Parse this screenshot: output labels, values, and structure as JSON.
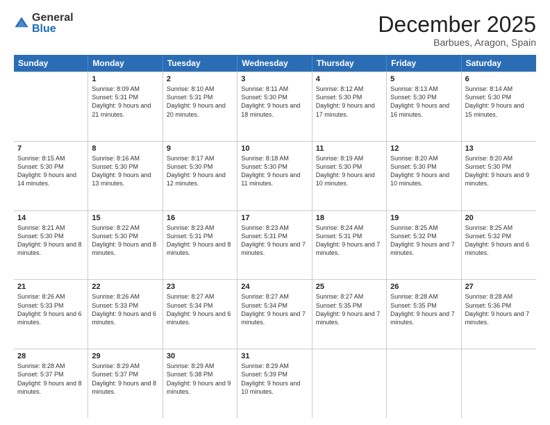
{
  "logo": {
    "general": "General",
    "blue": "Blue"
  },
  "header": {
    "month": "December 2025",
    "location": "Barbues, Aragon, Spain"
  },
  "weekdays": [
    "Sunday",
    "Monday",
    "Tuesday",
    "Wednesday",
    "Thursday",
    "Friday",
    "Saturday"
  ],
  "rows": [
    [
      {
        "day": "",
        "sunrise": "",
        "sunset": "",
        "daylight": ""
      },
      {
        "day": "1",
        "sunrise": "Sunrise: 8:09 AM",
        "sunset": "Sunset: 5:31 PM",
        "daylight": "Daylight: 9 hours and 21 minutes."
      },
      {
        "day": "2",
        "sunrise": "Sunrise: 8:10 AM",
        "sunset": "Sunset: 5:31 PM",
        "daylight": "Daylight: 9 hours and 20 minutes."
      },
      {
        "day": "3",
        "sunrise": "Sunrise: 8:11 AM",
        "sunset": "Sunset: 5:30 PM",
        "daylight": "Daylight: 9 hours and 18 minutes."
      },
      {
        "day": "4",
        "sunrise": "Sunrise: 8:12 AM",
        "sunset": "Sunset: 5:30 PM",
        "daylight": "Daylight: 9 hours and 17 minutes."
      },
      {
        "day": "5",
        "sunrise": "Sunrise: 8:13 AM",
        "sunset": "Sunset: 5:30 PM",
        "daylight": "Daylight: 9 hours and 16 minutes."
      },
      {
        "day": "6",
        "sunrise": "Sunrise: 8:14 AM",
        "sunset": "Sunset: 5:30 PM",
        "daylight": "Daylight: 9 hours and 15 minutes."
      }
    ],
    [
      {
        "day": "7",
        "sunrise": "Sunrise: 8:15 AM",
        "sunset": "Sunset: 5:30 PM",
        "daylight": "Daylight: 9 hours and 14 minutes."
      },
      {
        "day": "8",
        "sunrise": "Sunrise: 8:16 AM",
        "sunset": "Sunset: 5:30 PM",
        "daylight": "Daylight: 9 hours and 13 minutes."
      },
      {
        "day": "9",
        "sunrise": "Sunrise: 8:17 AM",
        "sunset": "Sunset: 5:30 PM",
        "daylight": "Daylight: 9 hours and 12 minutes."
      },
      {
        "day": "10",
        "sunrise": "Sunrise: 8:18 AM",
        "sunset": "Sunset: 5:30 PM",
        "daylight": "Daylight: 9 hours and 11 minutes."
      },
      {
        "day": "11",
        "sunrise": "Sunrise: 8:19 AM",
        "sunset": "Sunset: 5:30 PM",
        "daylight": "Daylight: 9 hours and 10 minutes."
      },
      {
        "day": "12",
        "sunrise": "Sunrise: 8:20 AM",
        "sunset": "Sunset: 5:30 PM",
        "daylight": "Daylight: 9 hours and 10 minutes."
      },
      {
        "day": "13",
        "sunrise": "Sunrise: 8:20 AM",
        "sunset": "Sunset: 5:30 PM",
        "daylight": "Daylight: 9 hours and 9 minutes."
      }
    ],
    [
      {
        "day": "14",
        "sunrise": "Sunrise: 8:21 AM",
        "sunset": "Sunset: 5:30 PM",
        "daylight": "Daylight: 9 hours and 8 minutes."
      },
      {
        "day": "15",
        "sunrise": "Sunrise: 8:22 AM",
        "sunset": "Sunset: 5:30 PM",
        "daylight": "Daylight: 9 hours and 8 minutes."
      },
      {
        "day": "16",
        "sunrise": "Sunrise: 8:23 AM",
        "sunset": "Sunset: 5:31 PM",
        "daylight": "Daylight: 9 hours and 8 minutes."
      },
      {
        "day": "17",
        "sunrise": "Sunrise: 8:23 AM",
        "sunset": "Sunset: 5:31 PM",
        "daylight": "Daylight: 9 hours and 7 minutes."
      },
      {
        "day": "18",
        "sunrise": "Sunrise: 8:24 AM",
        "sunset": "Sunset: 5:31 PM",
        "daylight": "Daylight: 9 hours and 7 minutes."
      },
      {
        "day": "19",
        "sunrise": "Sunrise: 8:25 AM",
        "sunset": "Sunset: 5:32 PM",
        "daylight": "Daylight: 9 hours and 7 minutes."
      },
      {
        "day": "20",
        "sunrise": "Sunrise: 8:25 AM",
        "sunset": "Sunset: 5:32 PM",
        "daylight": "Daylight: 9 hours and 6 minutes."
      }
    ],
    [
      {
        "day": "21",
        "sunrise": "Sunrise: 8:26 AM",
        "sunset": "Sunset: 5:33 PM",
        "daylight": "Daylight: 9 hours and 6 minutes."
      },
      {
        "day": "22",
        "sunrise": "Sunrise: 8:26 AM",
        "sunset": "Sunset: 5:33 PM",
        "daylight": "Daylight: 9 hours and 6 minutes."
      },
      {
        "day": "23",
        "sunrise": "Sunrise: 8:27 AM",
        "sunset": "Sunset: 5:34 PM",
        "daylight": "Daylight: 9 hours and 6 minutes."
      },
      {
        "day": "24",
        "sunrise": "Sunrise: 8:27 AM",
        "sunset": "Sunset: 5:34 PM",
        "daylight": "Daylight: 9 hours and 7 minutes."
      },
      {
        "day": "25",
        "sunrise": "Sunrise: 8:27 AM",
        "sunset": "Sunset: 5:35 PM",
        "daylight": "Daylight: 9 hours and 7 minutes."
      },
      {
        "day": "26",
        "sunrise": "Sunrise: 8:28 AM",
        "sunset": "Sunset: 5:35 PM",
        "daylight": "Daylight: 9 hours and 7 minutes."
      },
      {
        "day": "27",
        "sunrise": "Sunrise: 8:28 AM",
        "sunset": "Sunset: 5:36 PM",
        "daylight": "Daylight: 9 hours and 7 minutes."
      }
    ],
    [
      {
        "day": "28",
        "sunrise": "Sunrise: 8:28 AM",
        "sunset": "Sunset: 5:37 PM",
        "daylight": "Daylight: 9 hours and 8 minutes."
      },
      {
        "day": "29",
        "sunrise": "Sunrise: 8:29 AM",
        "sunset": "Sunset: 5:37 PM",
        "daylight": "Daylight: 9 hours and 8 minutes."
      },
      {
        "day": "30",
        "sunrise": "Sunrise: 8:29 AM",
        "sunset": "Sunset: 5:38 PM",
        "daylight": "Daylight: 9 hours and 9 minutes."
      },
      {
        "day": "31",
        "sunrise": "Sunrise: 8:29 AM",
        "sunset": "Sunset: 5:39 PM",
        "daylight": "Daylight: 9 hours and 10 minutes."
      },
      {
        "day": "",
        "sunrise": "",
        "sunset": "",
        "daylight": ""
      },
      {
        "day": "",
        "sunrise": "",
        "sunset": "",
        "daylight": ""
      },
      {
        "day": "",
        "sunrise": "",
        "sunset": "",
        "daylight": ""
      }
    ]
  ]
}
